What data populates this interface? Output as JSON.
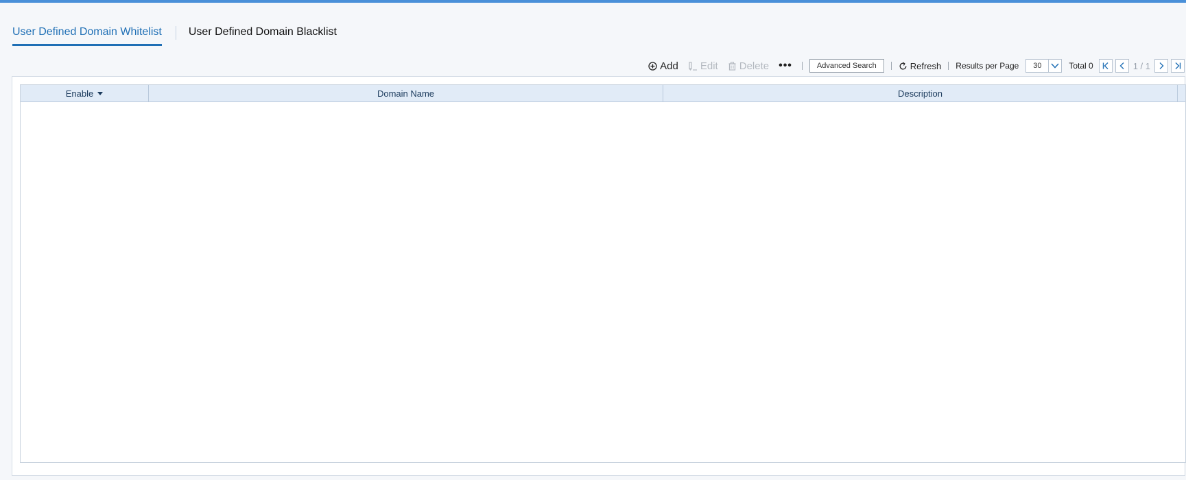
{
  "tabs": [
    {
      "label": "User Defined Domain Whitelist",
      "active": true
    },
    {
      "label": "User Defined Domain Blacklist",
      "active": false
    }
  ],
  "toolbar": {
    "add_label": "Add",
    "edit_label": "Edit",
    "delete_label": "Delete",
    "more_label": "•••",
    "advanced_search_label": "Advanced Search",
    "refresh_label": "Refresh",
    "results_per_page_label": "Results per Page",
    "results_per_page_value": "30",
    "total_label": "Total 0",
    "page_indicator": "1 / 1"
  },
  "table": {
    "columns": [
      {
        "label": "Enable",
        "sortable": true
      },
      {
        "label": "Domain Name"
      },
      {
        "label": "Description"
      }
    ],
    "rows": []
  },
  "icons": {
    "add": "plus-circle-icon",
    "edit": "pencil-icon",
    "delete": "trash-icon",
    "refresh": "refresh-icon",
    "dropdown": "chevron-down-icon",
    "first": "first-page-icon",
    "prev": "prev-page-icon",
    "next": "next-page-icon",
    "last": "last-page-icon"
  },
  "colors": {
    "accent": "#1f6fb5",
    "top_bar": "#4a90d9",
    "header_bg": "#e1ebf7",
    "disabled": "#b4b9c0"
  }
}
